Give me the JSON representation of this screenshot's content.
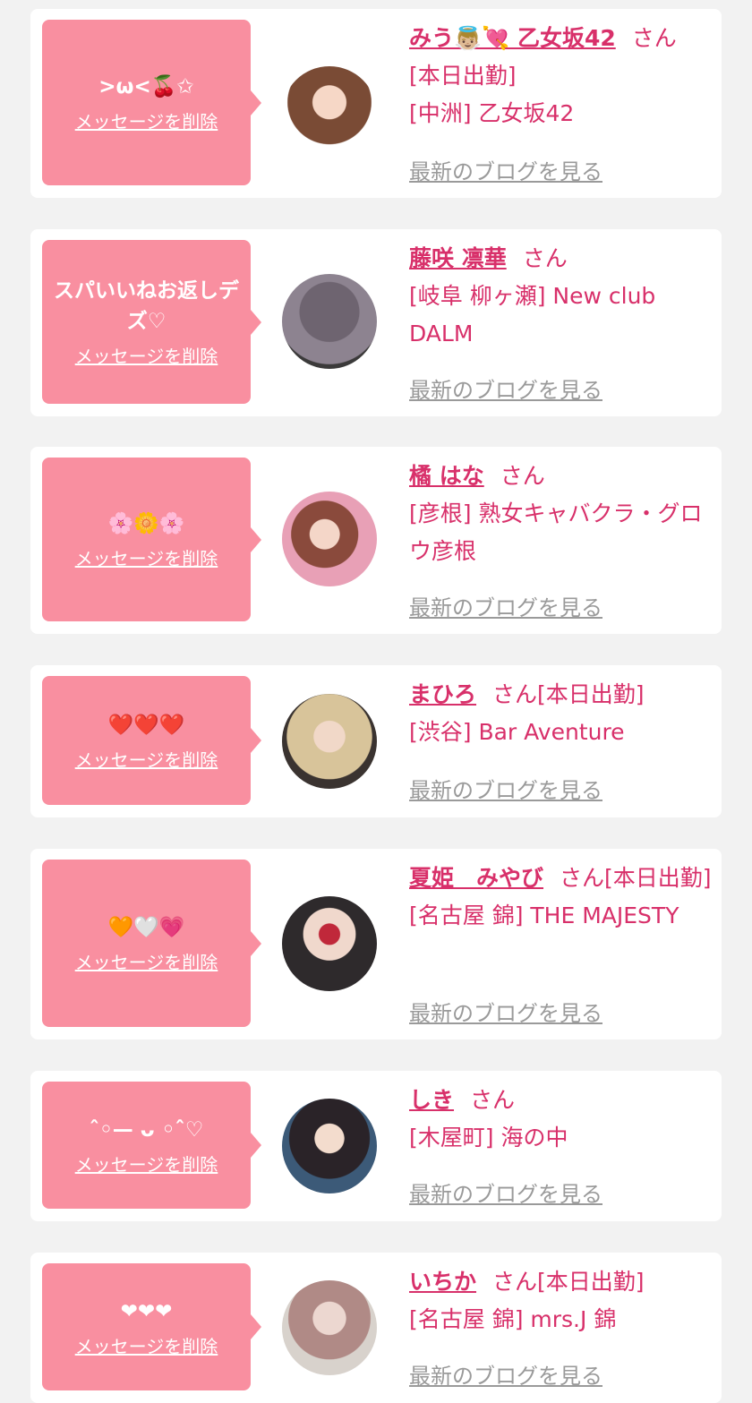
{
  "delete_label": "メッセージを削除",
  "blog_label": "最新のブログを見る",
  "honorific": "さん",
  "colors": {
    "accent": "#d8306a",
    "bubble": "#f98fa0",
    "muted": "#9a9a9a"
  },
  "cards": [
    {
      "message": ">ω<🍒✩",
      "name": "みう👼🏼💘 乙女坂42",
      "suffix": "",
      "lines": [
        "[本日出勤]",
        "[中洲] 乙女坂42"
      ],
      "avatar": "avatar-photo-icon"
    },
    {
      "message": "スパいいねお返しデズ♡",
      "name": "藤咲 凛華",
      "suffix": "",
      "lines": [
        "[岐阜 柳ヶ瀬] New club DALM"
      ],
      "avatar": "avatar-photo-icon"
    },
    {
      "message": "🌸🌼🌸",
      "name": "橘 はな",
      "suffix": "",
      "lines": [
        "[彦根] 熟女キャバクラ・グロウ彦根"
      ],
      "avatar": "avatar-photo-icon"
    },
    {
      "message": "❤️❤️❤️",
      "name": "まひろ",
      "suffix": "[本日出勤]",
      "lines": [
        "[渋谷] Bar Aventure"
      ],
      "avatar": "avatar-photo-icon"
    },
    {
      "message": "🧡🤍💗",
      "name": "夏姫　みやび",
      "suffix": "[本日出勤]",
      "lines": [
        "[名古屋 錦] THE MAJESTY"
      ],
      "avatar": "avatar-photo-icon"
    },
    {
      "message": "ˆ◦— ᴗ ◦ˆ♡",
      "name": "しき",
      "suffix": "",
      "lines": [
        "[木屋町] 海の中"
      ],
      "avatar": "avatar-photo-icon"
    },
    {
      "message": "❤︎❤︎❤︎",
      "name": "いちか",
      "suffix": "[本日出勤]",
      "lines": [
        "[名古屋 錦] mrs.J 錦"
      ],
      "avatar": "avatar-photo-icon"
    }
  ]
}
